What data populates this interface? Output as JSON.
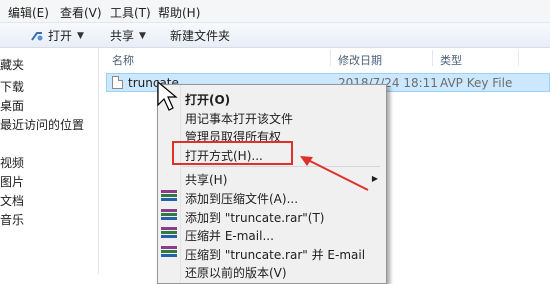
{
  "menubar": {
    "items": [
      "编辑(E)",
      "查看(V)",
      "工具(T)",
      "帮助(H)"
    ]
  },
  "toolbar": {
    "open_label": "打开",
    "share_label": "共享",
    "new_folder_label": "新建文件夹"
  },
  "nav": {
    "items": [
      "藏夹",
      "下载",
      "桌面",
      "最近访问的位置",
      "视频",
      "图片",
      "文档",
      "音乐"
    ]
  },
  "columns": {
    "name": "名称",
    "modified": "修改日期",
    "type": "类型"
  },
  "file": {
    "name": "truncate",
    "modified": "2018/7/24 18:11",
    "type": "AVP Key File"
  },
  "context_menu": {
    "items": [
      "打开(O)",
      "用记事本打开该文件",
      "管理员取得所有权",
      "打开方式(H)...",
      "共享(H)",
      "添加到压缩文件(A)...",
      "添加到 \"truncate.rar\"(T)",
      "压缩并 E-mail...",
      "压缩到 \"truncate.rar\" 并 E-mail",
      "还原以前的版本(V)"
    ]
  },
  "colors": {
    "selection": "#cce8ff",
    "highlight_box": "#e0302a"
  }
}
